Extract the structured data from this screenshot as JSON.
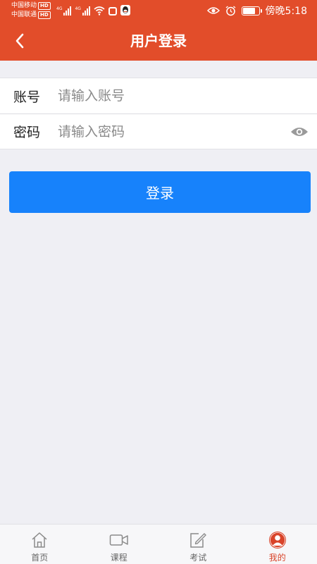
{
  "status_bar": {
    "carrier_1": "中国移动",
    "carrier_2": "中国联通",
    "hd_badge": "HD",
    "network_type": "4G",
    "time": "傍晚5:18",
    "battery_level": 0.8
  },
  "header": {
    "title": "用户登录"
  },
  "form": {
    "account_label": "账号",
    "account_placeholder": "请输入账号",
    "account_value": "",
    "password_label": "密码",
    "password_placeholder": "请输入密码",
    "password_value": ""
  },
  "login_button_label": "登录",
  "tabs": [
    {
      "label": "首页",
      "icon": "home-icon",
      "active": false
    },
    {
      "label": "课程",
      "icon": "video-camera-icon",
      "active": false
    },
    {
      "label": "考试",
      "icon": "edit-icon",
      "active": false
    },
    {
      "label": "我的",
      "icon": "user-icon",
      "active": true
    }
  ],
  "colors": {
    "header": "#e24d2a",
    "primary_button": "#1782fb",
    "active_tab": "#d9442a",
    "background": "#efeff4"
  }
}
